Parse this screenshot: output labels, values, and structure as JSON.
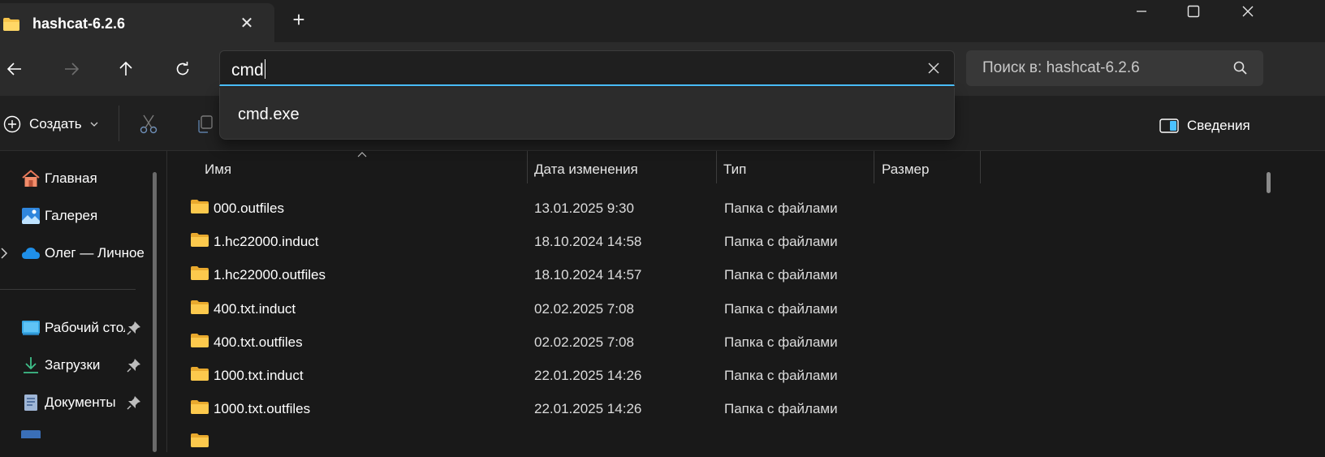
{
  "tab": {
    "title": "hashcat-6.2.6",
    "close_symbol": "✕",
    "new_tab_symbol": "+"
  },
  "address": {
    "value": "cmd",
    "clear_symbol": "✕"
  },
  "search": {
    "placeholder": "Поиск в: hashcat-6.2.6"
  },
  "suggestions": [
    {
      "label": "cmd.exe"
    }
  ],
  "toolbar": {
    "create_label": "Создать",
    "details_label": "Сведения"
  },
  "sidebar": {
    "items": [
      {
        "label": "Главная",
        "icon": "home-icon"
      },
      {
        "label": "Галерея",
        "icon": "gallery-icon"
      },
      {
        "label": "Олег — Личное",
        "icon": "onedrive-icon"
      }
    ],
    "pinned": [
      {
        "label": "Рабочий стол",
        "icon": "desktop-icon"
      },
      {
        "label": "Загрузки",
        "icon": "download-icon"
      },
      {
        "label": "Документы",
        "icon": "documents-icon"
      }
    ]
  },
  "columns": {
    "name": "Имя",
    "date": "Дата изменения",
    "type": "Тип",
    "size": "Размер"
  },
  "files": [
    {
      "name": "000.outfiles",
      "date": "13.01.2025 9:30",
      "type": "Папка с файлами"
    },
    {
      "name": "1.hc22000.induct",
      "date": "18.10.2024 14:58",
      "type": "Папка с файлами"
    },
    {
      "name": "1.hc22000.outfiles",
      "date": "18.10.2024 14:57",
      "type": "Папка с файлами"
    },
    {
      "name": "400.txt.induct",
      "date": "02.02.2025 7:08",
      "type": "Папка с файлами"
    },
    {
      "name": "400.txt.outfiles",
      "date": "02.02.2025 7:08",
      "type": "Папка с файлами"
    },
    {
      "name": "1000.txt.induct",
      "date": "22.01.2025 14:26",
      "type": "Папка с файлами"
    },
    {
      "name": "1000.txt.outfiles",
      "date": "22.01.2025 14:26",
      "type": "Папка с файлами"
    }
  ],
  "colors": {
    "accent": "#4cc2ff",
    "folder": "#f6c34a",
    "background": "#191919"
  }
}
